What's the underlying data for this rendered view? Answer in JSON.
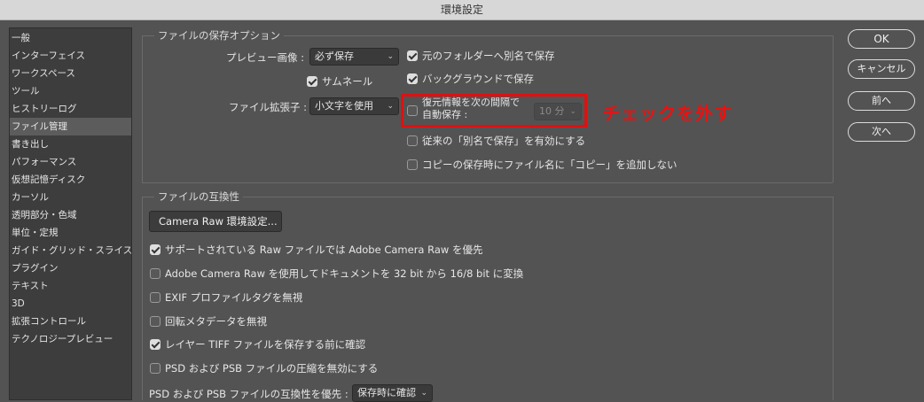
{
  "window": {
    "title": "環境設定"
  },
  "sidebar": {
    "items": [
      {
        "label": "一般"
      },
      {
        "label": "インターフェイス"
      },
      {
        "label": "ワークスペース"
      },
      {
        "label": "ツール"
      },
      {
        "label": "ヒストリーログ"
      },
      {
        "label": "ファイル管理",
        "selected": true
      },
      {
        "label": "書き出し"
      },
      {
        "label": "パフォーマンス"
      },
      {
        "label": "仮想記憶ディスク"
      },
      {
        "label": "カーソル"
      },
      {
        "label": "透明部分・色域"
      },
      {
        "label": "単位・定規"
      },
      {
        "label": "ガイド・グリッド・スライス"
      },
      {
        "label": "プラグイン"
      },
      {
        "label": "テキスト"
      },
      {
        "label": "3D"
      },
      {
        "label": "拡張コントロール"
      },
      {
        "label": "テクノロジープレビュー"
      }
    ]
  },
  "save_options": {
    "title": "ファイルの保存オプション",
    "preview_label": "プレビュー画像 :",
    "preview_value": "必ず保存",
    "thumbnail": {
      "label": "サムネール",
      "checked": true
    },
    "extension_label": "ファイル拡張子 :",
    "extension_value": "小文字を使用",
    "save_as_original_folder": {
      "label": "元のフォルダーへ別名で保存",
      "checked": true
    },
    "background_save": {
      "label": "バックグラウンドで保存",
      "checked": true
    },
    "auto_save": {
      "label_line1": "復元情報を次の間隔で",
      "label_line2": "自動保存 :",
      "checked": false
    },
    "auto_save_interval": "10 分",
    "legacy_save_as": {
      "label": "従来の「別名で保存」を有効にする",
      "checked": false
    },
    "no_copy_suffix": {
      "label": "コピーの保存時にファイル名に「コピー」を追加しない",
      "checked": false
    }
  },
  "annotation": {
    "text": "チェックを外す",
    "color": "#e81212"
  },
  "compatibility": {
    "title": "ファイルの互換性",
    "camera_raw_button": "Camera Raw 環境設定...",
    "options": [
      {
        "label": "サポートされている Raw ファイルでは Adobe Camera Raw を優先",
        "checked": true
      },
      {
        "label": "Adobe Camera Raw を使用してドキュメントを 32 bit から 16/8 bit に変換",
        "checked": false
      },
      {
        "label": "EXIF プロファイルタグを無視",
        "checked": false
      },
      {
        "label": "回転メタデータを無視",
        "checked": false
      },
      {
        "label": "レイヤー TIFF ファイルを保存する前に確認",
        "checked": true
      },
      {
        "label": "PSD および PSB ファイルの圧縮を無効にする",
        "checked": false
      }
    ],
    "psd_compat_label": "PSD および PSB ファイルの互換性を優先 :",
    "psd_compat_value": "保存時に確認"
  },
  "buttons": {
    "ok": "OK",
    "cancel": "キャンセル",
    "prev": "前へ",
    "next": "次へ"
  }
}
